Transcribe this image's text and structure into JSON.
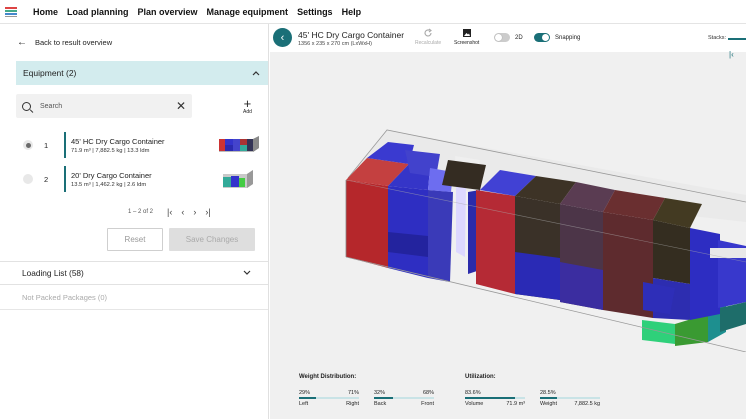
{
  "nav": {
    "items": [
      "Home",
      "Load planning",
      "Plan overview",
      "Manage equipment",
      "Settings",
      "Help"
    ]
  },
  "left": {
    "back_label": "Back to result overview",
    "equipment_header": "Equipment (2)",
    "search_placeholder": "Search",
    "add_label": "Add",
    "equipment": [
      {
        "num": "1",
        "name": "45' HC Dry Cargo Container",
        "details": "71.9 m³ | 7,882.5 kg | 13.3 ldm",
        "selected": true
      },
      {
        "num": "2",
        "name": "20' Dry Cargo Container",
        "details": "13.5 m³ | 1,462.2 kg | 2.6 ldm",
        "selected": false
      }
    ],
    "pagination": "1 – 2 of 2",
    "reset_label": "Reset",
    "save_label": "Save Changes",
    "loading_list": "Loading List (58)",
    "not_packed": "Not Packed Packages (0)"
  },
  "container": {
    "title": "45' HC Dry Cargo Container",
    "dims": "1356 x 235 x 270 cm (LxWxH)",
    "recalculate": "Recalculate",
    "screenshot": "Screenshot",
    "toggle_2d": "2D",
    "toggle_snapping": "Snapping",
    "stacks": "Stacks:"
  },
  "stats": {
    "weight_title": "Weight Distribution:",
    "util_title": "Utilization:",
    "left_pct": "29%",
    "left_label": "Left",
    "right_pct": "71%",
    "right_label": "Right",
    "back_pct": "32%",
    "back_label": "Back",
    "front_pct": "68%",
    "front_label": "Front",
    "volume_pct": "83.6%",
    "volume_label": "Volume",
    "volume_value": "71.9 m³",
    "weight_pct": "28.5%",
    "weight_label": "Weight",
    "weight_value": "7,882.5 kg",
    "fills": {
      "left_right": 0.29,
      "back_front": 0.32,
      "volume": 0.836,
      "weight": 0.285
    }
  },
  "colors": {
    "accent": "#1a6f77",
    "header_bg": "#d3ecee"
  }
}
